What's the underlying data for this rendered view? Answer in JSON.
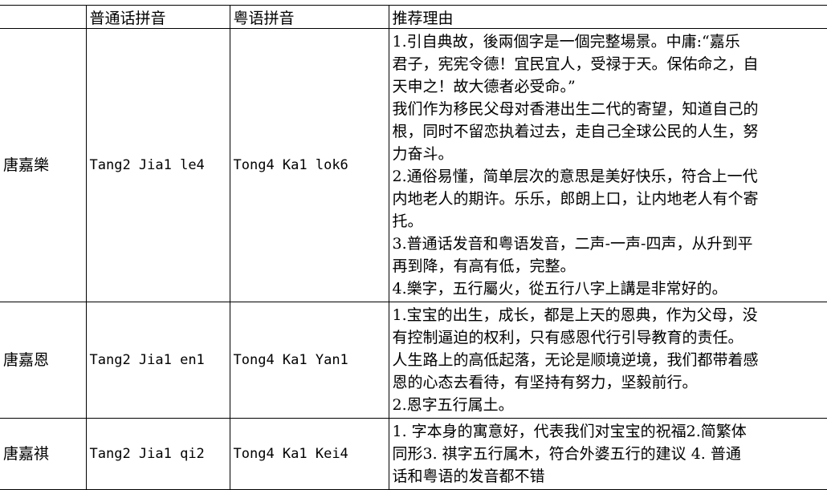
{
  "headers": [
    "",
    "普通话拼音",
    "粤语拼音",
    "推荐理由"
  ],
  "rows": [
    {
      "name": "唐嘉樂",
      "mandarin": "Tang2 Jia1 le4",
      "cantonese": "Tong4 Ka1 lok6",
      "reason_lines": [
        "1.引自典故，後兩個字是一個完整場景。中庸:“嘉乐",
        "君子，宪宪令德！宜民宜人，受禄于天。保佑命之，自",
        "天申之！故大德者必受命。”",
        "我们作为移民父母对香港出生二代的寄望，知道自己的",
        "根，同时不留恋执着过去，走自己全球公民的人生，努",
        "力奋斗。",
        "2.通俗易懂，简单层次的意思是美好快乐，符合上一代",
        "内地老人的期许。乐乐，郎朗上口，让内地老人有个寄",
        "托。",
        "3.普通话发音和粤语发音，二声-一声-四声，从升到平",
        "再到降，有高有低，完整。",
        "4.樂字，五行屬火，從五行八字上講是非常好的。"
      ]
    },
    {
      "name": "唐嘉恩",
      "mandarin": "Tang2 Jia1 en1",
      "cantonese": "Tong4 Ka1 Yan1",
      "reason_lines": [
        "1.宝宝的出生，成长，都是上天的恩典，作为父母，没",
        "有控制逼迫的权利，只有感恩代行引导教育的责任。",
        "人生路上的高低起落，无论是顺境逆境，我们都带着感",
        "恩的心态去看待，有坚持有努力，坚毅前行。",
        "2.恩字五行属土。"
      ]
    },
    {
      "name": "唐嘉祺",
      "mandarin": "Tang2 Jia1 qi2",
      "cantonese": "Tong4 Ka1 Kei4",
      "reason_lines": [
        "1. 字本身的寓意好，代表我们对宝宝的祝福2.简繁体",
        "同形3. 祺字五行属木，符合外婆五行的建议 4. 普通",
        "话和粤语的发音都不错"
      ]
    }
  ]
}
